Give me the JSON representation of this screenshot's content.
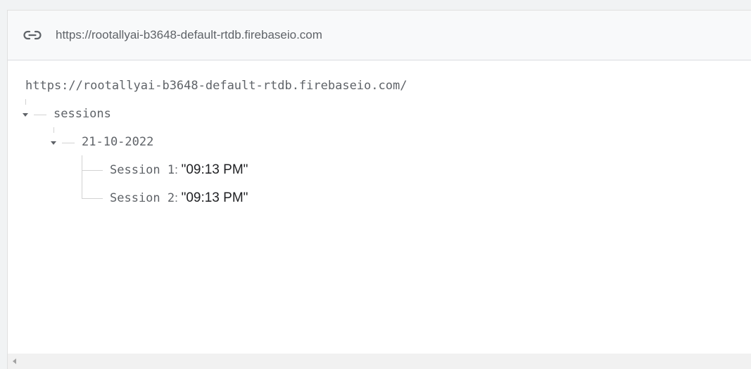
{
  "urlbar": {
    "icon": "link-icon",
    "url": "https://rootallyai-b3648-default-rtdb.firebaseio.com"
  },
  "tree": {
    "root_url": "https://rootallyai-b3648-default-rtdb.firebaseio.com/",
    "sessions_key": "sessions",
    "date_key": "21-10-2022",
    "leaves": [
      {
        "key": "Session 1",
        "value": "\"09:13 PM\""
      },
      {
        "key": "Session 2",
        "value": "\"09:13 PM\""
      }
    ]
  },
  "colors": {
    "panel_bg": "#ffffff",
    "urlbar_bg": "#f8f9fa",
    "text_muted": "#5f6368",
    "text_value": "#202124"
  }
}
